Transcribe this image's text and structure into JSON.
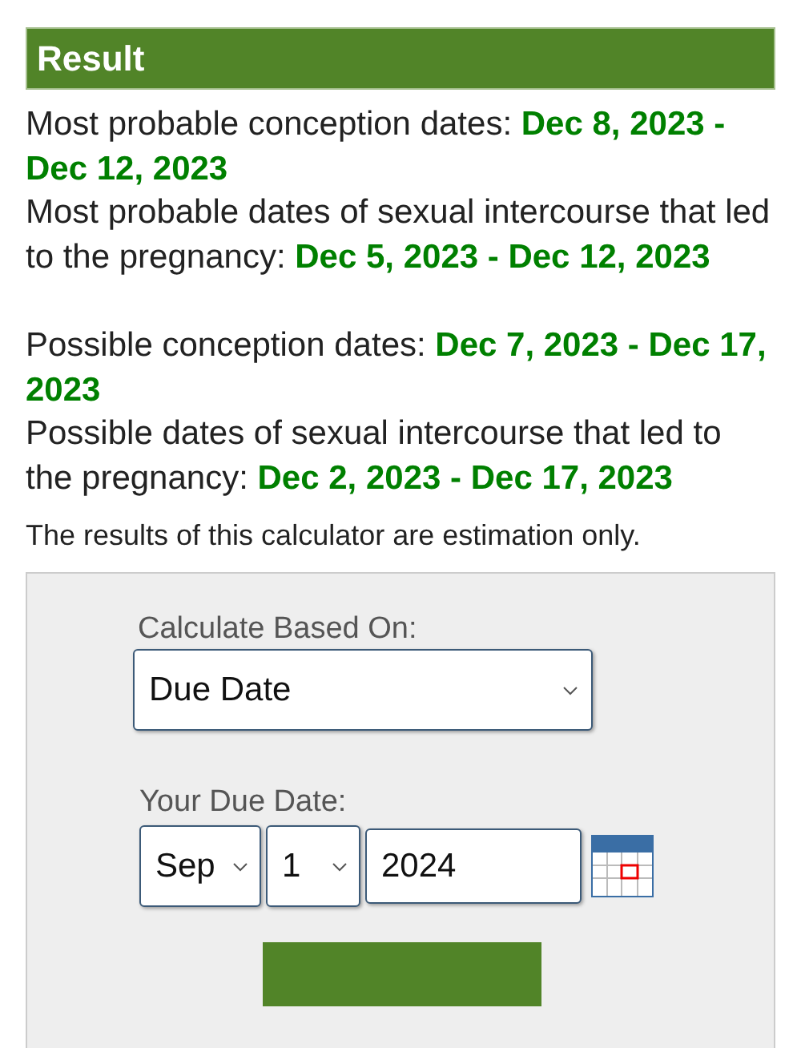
{
  "result": {
    "title": "Result",
    "paragraphs": [
      {
        "lines": [
          "Most probable conception dates: **Dec 8, 2023 - Dec 12, 2023**",
          "Most probable dates of sexual intercourse that led to the pregnancy: **Dec 5, 2023 - Dec 12, 2023**"
        ]
      },
      {
        "lines": [
          "Possible conception dates: **Dec 7, 2023 - Dec 17, 2023**",
          "Possible dates of sexual intercourse that led to the pregnancy: **Dec 2, 2023 - Dec 17, 2023**"
        ]
      }
    ],
    "note": "The results of this calculator are estimation only."
  },
  "form": {
    "based_on": {
      "label": "Calculate Based On:",
      "value": "Due Date"
    },
    "due_date": {
      "label": "Your Due Date:",
      "month": "Sep",
      "day": "1",
      "year": "2024"
    }
  }
}
